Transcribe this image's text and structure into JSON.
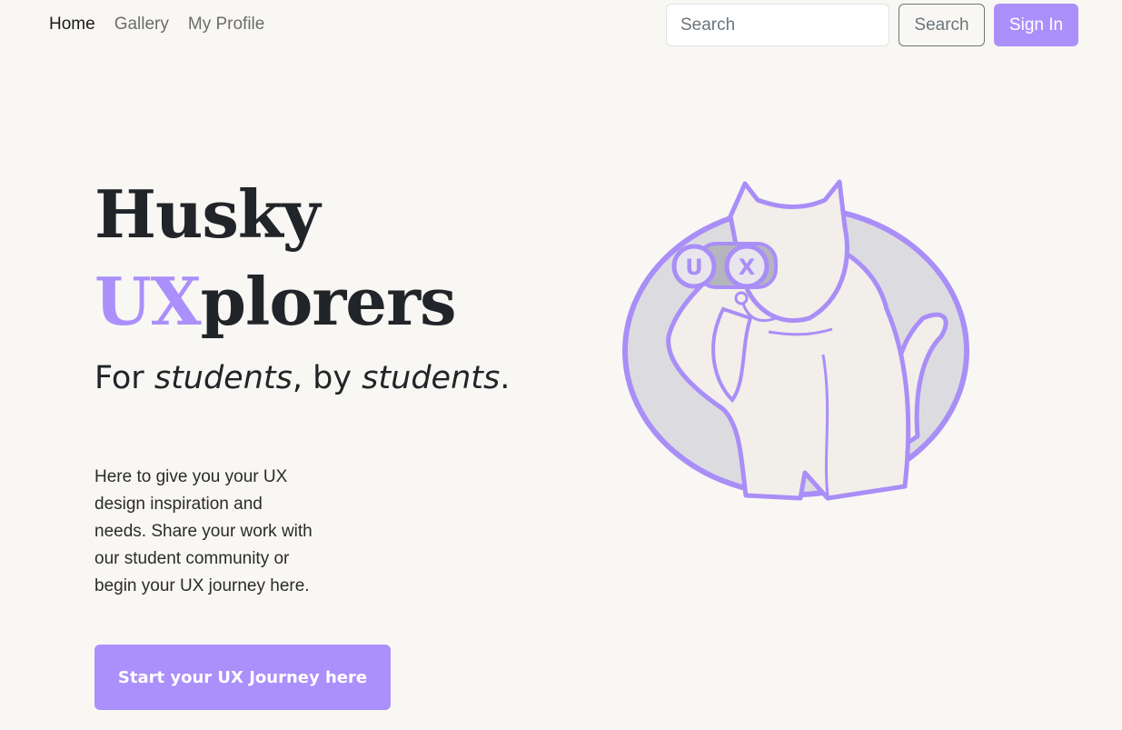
{
  "nav": {
    "links": [
      {
        "label": "Home",
        "active": true
      },
      {
        "label": "Gallery",
        "active": false
      },
      {
        "label": "My Profile",
        "active": false
      }
    ],
    "search_placeholder": "Search",
    "search_button": "Search",
    "signin_button": "Sign In"
  },
  "hero": {
    "title_line1": "Husky",
    "title_accent": "UX",
    "title_rest": "plorers",
    "tagline_1": "For ",
    "tagline_em1": "students",
    "tagline_2": ", by ",
    "tagline_em2": "students",
    "tagline_3": ".",
    "intro": "Here to give you your UX design inspiration and needs. Share your work with our student community or begin your UX journey here.",
    "cta": "Start your UX Journey here"
  },
  "mascot": {
    "binocular_left": "U",
    "binocular_right": "X"
  },
  "colors": {
    "accent": "#ab8ffb",
    "background": "#f9f7f3",
    "mascot_circle": "#dcdce0",
    "mascot_body": "#f2eee9"
  }
}
